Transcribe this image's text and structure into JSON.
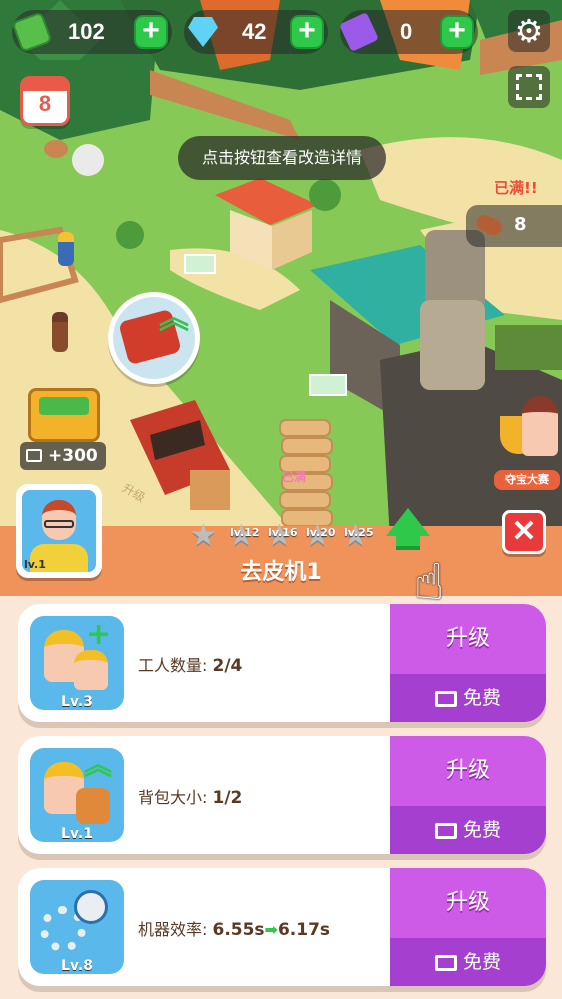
{
  "hud": {
    "cash": "102",
    "gems": "42",
    "tickets": "0",
    "plus_symbol": "+",
    "calendar_day": "8"
  },
  "tooltip": "点击按钮查看改造详情",
  "map": {
    "full_label": "已满!!",
    "log_count": "8",
    "reward_amount": "+300",
    "event_label": "夺宝大赛",
    "road_label": "升级",
    "stack_label": "已满"
  },
  "panel": {
    "title": "去皮机1",
    "worker_level": "lv.1",
    "milestones": [
      "lv.12",
      "lv.16",
      "lv.20",
      "lv.25"
    ],
    "cards": [
      {
        "label": "工人数量: ",
        "value": "2/4",
        "icon_level": "Lv.3",
        "upgrade_label": "升级",
        "free_label": "免费"
      },
      {
        "label": "背包大小: ",
        "value": "1/2",
        "icon_level": "Lv.1",
        "upgrade_label": "升级",
        "free_label": "免费"
      },
      {
        "label": "机器效率: ",
        "value": "6.55s",
        "value_to": "6.17s",
        "icon_level": "Lv.8",
        "upgrade_label": "升级",
        "free_label": "免费"
      }
    ]
  },
  "colors": {
    "header_orange": "#f0935b",
    "upgrade_purple": "#cd5be8",
    "free_purple": "#a43fd0",
    "plus_green": "#2ec94a",
    "close_red": "#e83a3a",
    "arrow_green": "#2ec94a"
  }
}
